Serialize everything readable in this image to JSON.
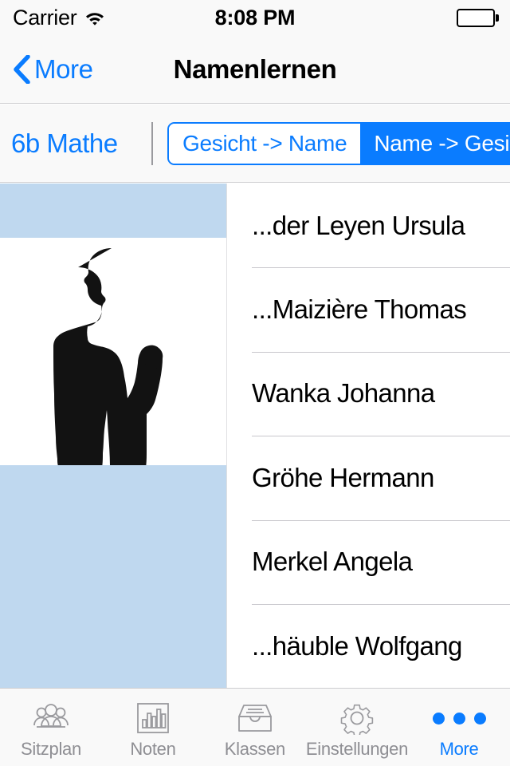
{
  "status_bar": {
    "carrier": "Carrier",
    "wifi_icon": "wifi-icon",
    "time": "8:08 PM",
    "battery_icon": "battery-full-icon"
  },
  "nav_bar": {
    "back_icon": "chevron-left-icon",
    "back_label": "More",
    "title": "Namenlernen"
  },
  "toolbar": {
    "class_label": "6b Mathe",
    "segments": [
      {
        "label": "Gesicht -> Name",
        "selected": false
      },
      {
        "label": "Name -> Gesicht",
        "selected": true
      }
    ]
  },
  "content": {
    "photo": {
      "icon": "person-silhouette-image",
      "background_color": "#bfd8ef"
    },
    "names": [
      "...der Leyen Ursula",
      "...Maizière Thomas",
      "Wanka Johanna",
      "Gröhe Hermann",
      "Merkel Angela",
      "...häuble Wolfgang"
    ]
  },
  "tab_bar": {
    "items": [
      {
        "label": "Sitzplan",
        "icon": "people-group-icon",
        "active": false
      },
      {
        "label": "Noten",
        "icon": "bar-chart-icon",
        "active": false
      },
      {
        "label": "Klassen",
        "icon": "file-box-icon",
        "active": false
      },
      {
        "label": "Einstellungen",
        "icon": "gear-icon",
        "active": false
      },
      {
        "label": "More",
        "icon": "ellipsis-icon",
        "active": true
      }
    ]
  },
  "colors": {
    "accent": "#0a7cff",
    "inactive": "#8e8e93",
    "band": "#bfd8ef",
    "bar_background": "#f9f9f9"
  }
}
